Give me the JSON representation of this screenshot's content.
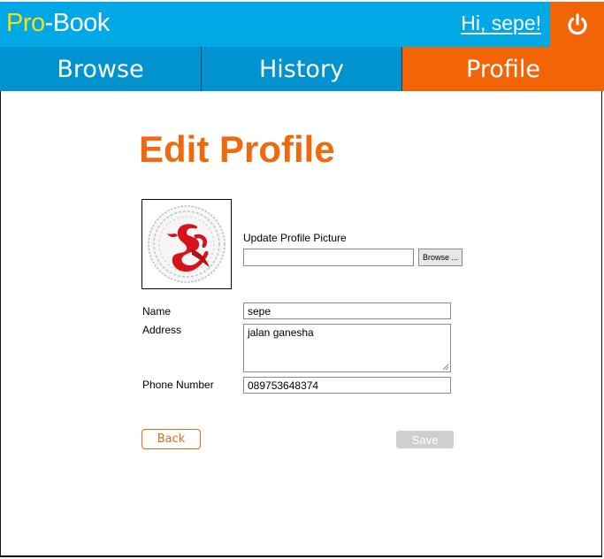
{
  "header": {
    "logo_pro": "Pro",
    "logo_rest": "-Book",
    "greeting": "Hi, sepe!",
    "logout_icon": "power-icon"
  },
  "nav": {
    "tabs": [
      {
        "label": "Browse",
        "active": false
      },
      {
        "label": "History",
        "active": false
      },
      {
        "label": "Profile",
        "active": true
      }
    ]
  },
  "page": {
    "title": "Edit Profile"
  },
  "profile_picture": {
    "upload_label": "Update Profile Picture",
    "file_value": "",
    "browse_label": "Browse ..."
  },
  "form": {
    "name_label": "Name",
    "name_value": "sepe",
    "address_label": "Address",
    "address_value": "jalan ganesha",
    "phone_label": "Phone Number",
    "phone_value": "089753648374"
  },
  "actions": {
    "back_label": "Back",
    "save_label": "Save"
  },
  "colors": {
    "brand_blue": "#00a8e6",
    "nav_blue": "#0093cf",
    "accent_orange": "#f26506",
    "logo_yellow": "#f5e10a"
  }
}
